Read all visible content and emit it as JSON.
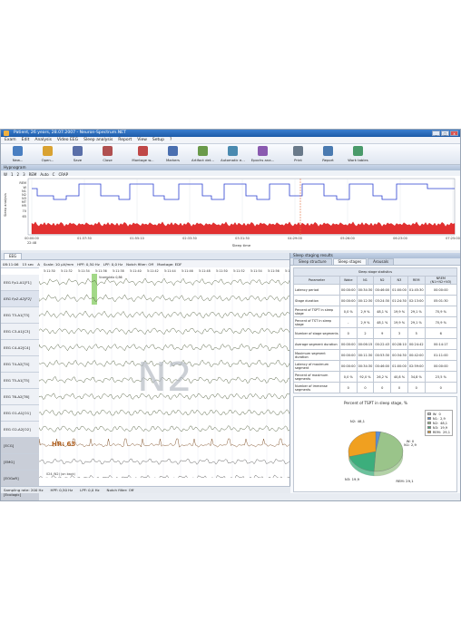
{
  "window": {
    "title": "Patient, 26 years, 28.07.2007 - Neuron-Spectrum.NET"
  },
  "menu": [
    "Exam",
    "Edit",
    "Analysis",
    "Video EEG",
    "Sleep analysis",
    "Report",
    "View",
    "Setup",
    "?"
  ],
  "toolbar": [
    {
      "label": "New...",
      "icon": "new-icon",
      "color": "#4a7fc1"
    },
    {
      "label": "Open...",
      "icon": "open-icon",
      "color": "#d9a232"
    },
    {
      "label": "Save",
      "icon": "save-icon",
      "color": "#5a6fa8"
    },
    {
      "label": "Close",
      "icon": "close-icon",
      "color": "#b05050"
    },
    {
      "label": "Montage w...",
      "icon": "montage-icon",
      "color": "#c04848"
    },
    {
      "label": "Markers",
      "icon": "markers-icon",
      "color": "#4a6fb0"
    },
    {
      "label": "Artifact det...",
      "icon": "artifact-icon",
      "color": "#6a9a4a"
    },
    {
      "label": "Automatic e...",
      "icon": "automatic-icon",
      "color": "#4a8ab0"
    },
    {
      "label": "Epochs ana...",
      "icon": "epochs-icon",
      "color": "#8a5ab0"
    },
    {
      "label": "Print",
      "icon": "print-icon",
      "color": "#6a7a8a"
    },
    {
      "label": "Report",
      "icon": "report-icon",
      "color": "#4a7ab0"
    },
    {
      "label": "Work tables",
      "icon": "tables-icon",
      "color": "#4a9a6a"
    }
  ],
  "hypnogram": {
    "panel_title": "Hypnogram",
    "tools": [
      "W",
      "1",
      "2",
      "3",
      "REM",
      "Auto",
      "C",
      "CRAP"
    ],
    "y_labels": [
      "REM",
      "W",
      "N1",
      "N2",
      "N3",
      "MT",
      "HR",
      "70",
      "65"
    ],
    "axis_title": "Sleep analysis",
    "time_labels": [
      "00:00:00",
      "01:37:30",
      "01:55:10",
      "02:33:30",
      "03:31:30",
      "04:29:00",
      "05:26:00",
      "06:23:00",
      "07:25:00"
    ],
    "time_sub": "22:48",
    "x_title": "Sleep time"
  },
  "eeg": {
    "tabs": [
      "EEG"
    ],
    "toolbar": [
      "08:11:06",
      "15 sec",
      "A",
      "Scale: 10 µV/mm",
      "HPF: 0,50 Hz",
      "LPF: 0,0 Hz",
      "Notch filter: Off",
      "Montage: EDF"
    ],
    "time_ticks": [
      "5:11:30",
      "5:11:32",
      "5:11:34",
      "5:11:36",
      "5:11:38",
      "5:11:40",
      "5:11:42",
      "5:11:44",
      "5:11:46",
      "5:11:48",
      "5:11:50",
      "5:11:52",
      "5:11:54",
      "5:11:56",
      "5:11"
    ],
    "channels": [
      "EEG Fp1-A1[F1]",
      "EEG Fp2-A2[F2]",
      "EEG T3-A1[T3]",
      "EEG C3-A1[C3]",
      "EEG C4-A2[C4]",
      "EEG T4-A2[T4]",
      "EEG T5-A1[T5]",
      "EEG T6-A2[T6]",
      "EEG O1-A1[O1]",
      "EEG O2-A2[O2]",
      "[ECG]",
      "[EMG]",
      "[EOGoR]",
      "[Ecologic]"
    ],
    "marker": "Vcompleio 0,86",
    "hr_label": "HR: 63",
    "stage": "N2",
    "epoch_label": "024  (N2) (on back)",
    "status": [
      "Sampling rate: 200 Hz",
      "HPF: 0,50 Hz",
      "LPF: 0,0 Hz",
      "Notch filter: Off"
    ]
  },
  "results": {
    "panel_title": "Sleep staging results",
    "tabs": [
      "Sleep structure",
      "Sleep stages",
      "Arousals"
    ],
    "table_title": "Sleep stage statistics",
    "columns": [
      "Parameter",
      "Wake",
      "N1",
      "N2",
      "N3",
      "REM",
      "NREM (N1+N2+N3)"
    ],
    "rows": [
      [
        "Latency period",
        "00:00:00",
        "00:34:30",
        "00:46:00",
        "01:00:00",
        "01:45:30",
        "00:00:00"
      ],
      [
        "Stage duration",
        "00:00:00",
        "00:12:30",
        "03:24:30",
        "01:24:30",
        "02:13:00",
        "05:01:30"
      ],
      [
        "Percent of TSPT in sleep stage",
        "0,0 %",
        "2,9 %",
        "48,1 %",
        "19,9 %",
        "29,1 %",
        "70,9 %"
      ],
      [
        "Percent of TST in sleep stage",
        "-",
        "2,9 %",
        "48,1 %",
        "19,9 %",
        "29,1 %",
        "70,9 %"
      ],
      [
        "Number of stage segments",
        "0",
        "2",
        "9",
        "3",
        "5",
        "6"
      ],
      [
        "Average segment duration",
        "00:00:00",
        "00:06:15",
        "00:22:43",
        "00:28:10",
        "00:24:42",
        "00:14:17"
      ],
      [
        "Maximum segment duration",
        "00:00:00",
        "00:11:30",
        "00:53:30",
        "00:34:30",
        "00:42:00",
        "01:11:00"
      ],
      [
        "Latency of maximum segment",
        "00:00:00",
        "00:34:30",
        "00:46:00",
        "01:00:00",
        "02:59:00",
        "00:00:00"
      ],
      [
        "Percent of maximum segments",
        "0,0 %",
        "92,0 %",
        "26,2 %",
        "40,8 %",
        "34,8 %",
        "23,5 %"
      ],
      [
        "Number of immense segments",
        "0",
        "0",
        "0",
        "0",
        "0",
        "0"
      ]
    ]
  },
  "chart_data": {
    "type": "pie",
    "title": "Percent of TSPT in sleep stage, %",
    "series": [
      {
        "values": [
          0,
          2.9,
          48.1,
          19.9,
          29.1
        ]
      }
    ],
    "categories": [
      "W",
      "N1",
      "N2",
      "N3",
      "REM"
    ],
    "legend": [
      "W:",
      "N1:",
      "N2:",
      "N3:",
      "REM:"
    ],
    "legend_values": [
      "0",
      "2,9",
      "48,1",
      "19,9",
      "29,1"
    ],
    "slice_labels": [
      "W: 0",
      "N1: 2,9",
      "N2: 48,1",
      "N3: 19,9",
      "REM: 29,1"
    ],
    "colors": [
      "#c8c8c8",
      "#5b8fd6",
      "#9ac48a",
      "#3cae7c",
      "#f0a020"
    ],
    "legend_position": "top-right"
  }
}
